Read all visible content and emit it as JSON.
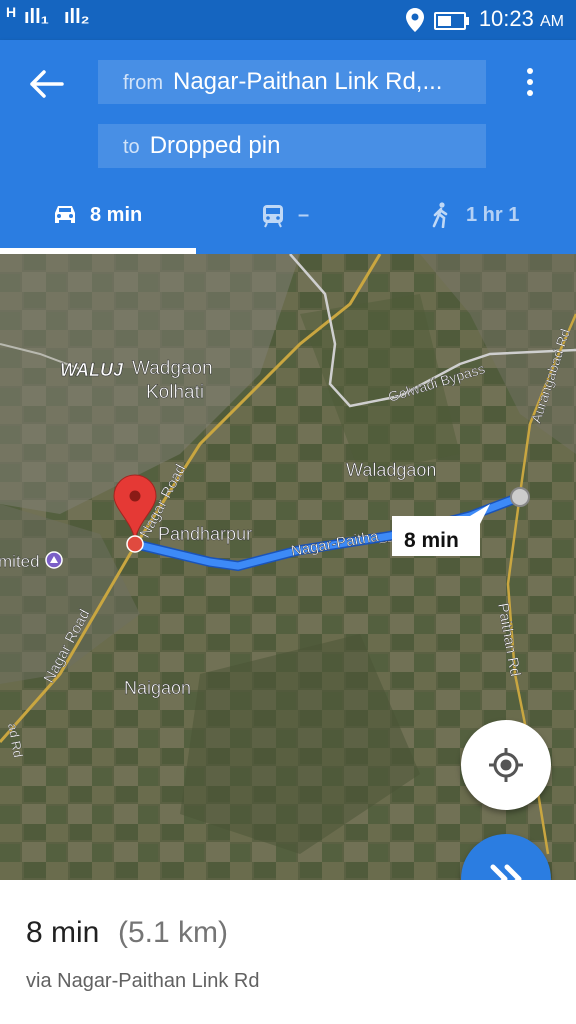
{
  "status_bar": {
    "signal_1": "H",
    "signal_1_bars": "ıll₁",
    "signal_2": "ıll₂",
    "icons": [
      "location-icon",
      "battery-icon"
    ],
    "battery_level": 0.55,
    "time": "10:23",
    "ampm": "AM"
  },
  "directions": {
    "from_label": "from",
    "from_value": "Nagar-Paithan Link Rd,...",
    "to_label": "to",
    "to_value": "Dropped pin",
    "back_icon": "back-arrow-icon",
    "more_icon": "more-vert-icon"
  },
  "modes": [
    {
      "icon": "car-icon",
      "label": "8 min",
      "selected": true
    },
    {
      "icon": "transit-icon",
      "label": "–",
      "selected": false
    },
    {
      "icon": "walk-icon",
      "label": "1 hr 1",
      "selected": false
    }
  ],
  "map": {
    "labels": {
      "waluj": "WALUJ",
      "wadgaon": "Wadgaon",
      "kolhati": "Kolhati",
      "golwadi": "Golwadi Bypass",
      "aurangabad": "Aurangabad Rd",
      "waladgaon": "Waladgaon",
      "pandharpur": "Pandharpur",
      "nagar_paithan": "Nagar-Paitha___k Rd",
      "nagar_road_1": "Nagar Road",
      "nagar_road_2": "Nagar Road",
      "paithan_rd": "Paithan Rd",
      "naigaon": "Naigaon",
      "limited": "mited",
      "edge_rd": "ad Rd"
    },
    "route_time": "8 min",
    "route_color": "#3d8af7",
    "pin_color": "#e53935"
  },
  "fab": {
    "locate_icon": "my-location-icon",
    "navigate_icon": "start-navigation-icon"
  },
  "summary": {
    "duration": "8 min",
    "distance": "(5.1 km)",
    "via": "via Nagar-Paithan Link Rd"
  }
}
